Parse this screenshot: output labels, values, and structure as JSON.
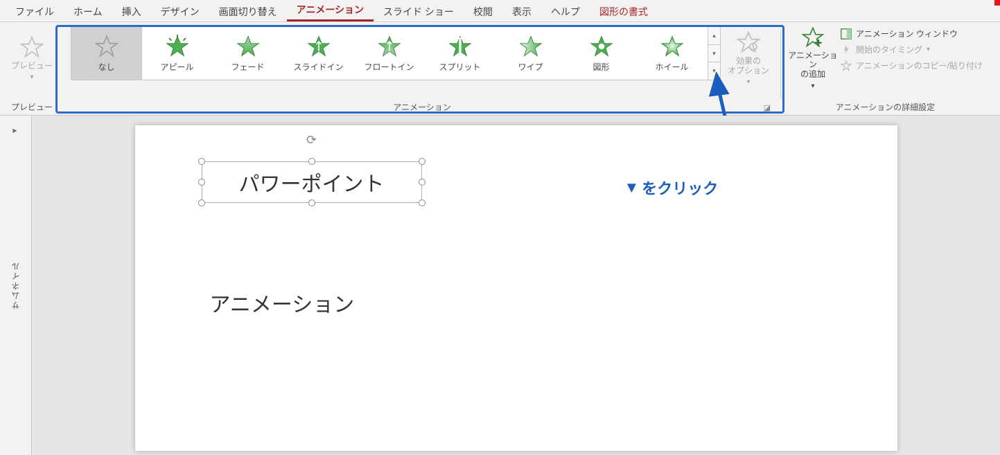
{
  "tabs": {
    "file": "ファイル",
    "home": "ホーム",
    "insert": "挿入",
    "design": "デザイン",
    "transitions": "画面切り替え",
    "animations": "アニメーション",
    "slideshow": "スライド ショー",
    "review": "校閲",
    "view": "表示",
    "help": "ヘルプ",
    "shape_format": "図形の書式"
  },
  "ribbon": {
    "preview": {
      "button": "プレビュー",
      "group_label": "プレビュー"
    },
    "animation": {
      "items": [
        {
          "label": "なし"
        },
        {
          "label": "アピール"
        },
        {
          "label": "フェード"
        },
        {
          "label": "スライドイン"
        },
        {
          "label": "フロートイン"
        },
        {
          "label": "スプリット"
        },
        {
          "label": "ワイプ"
        },
        {
          "label": "図形"
        },
        {
          "label": "ホイール"
        }
      ],
      "effect_options": "効果の\nオプション",
      "group_label": "アニメーション"
    },
    "advanced": {
      "add_animation": "アニメーション\nの追加",
      "pane": "アニメーション ウィンドウ",
      "trigger": "開始のタイミング",
      "painter": "アニメーションのコピー/貼り付け",
      "group_label": "アニメーションの詳細設定"
    }
  },
  "thumb_rail": "サムネイル",
  "slide": {
    "textbox_text": "パワーポイント",
    "body_text": "アニメーション"
  },
  "annotation": {
    "marker": "▼",
    "text": "をクリック"
  }
}
